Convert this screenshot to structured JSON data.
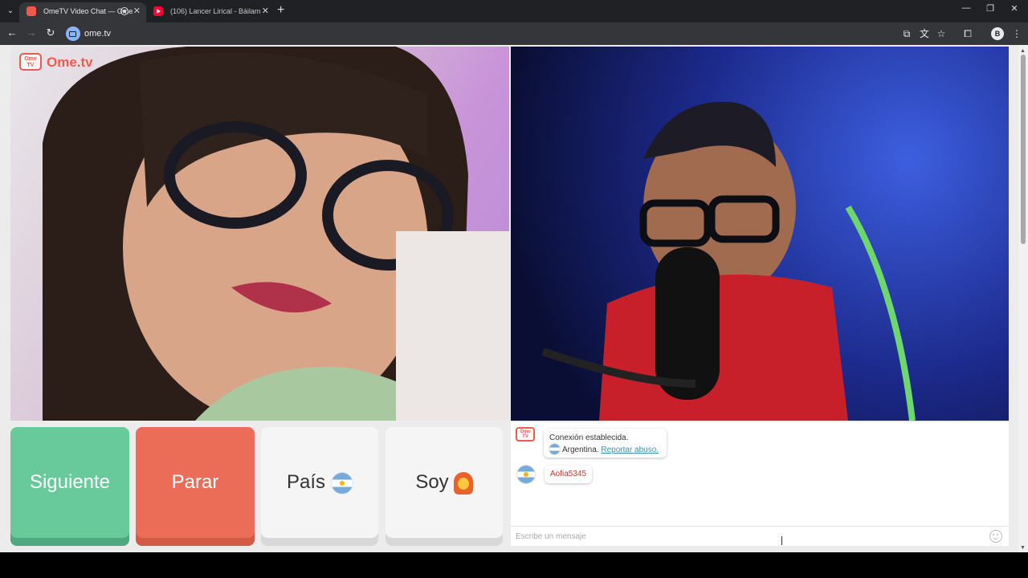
{
  "browser": {
    "tabs": [
      {
        "title": "OmeTV Video Chat — Ome",
        "active": true
      },
      {
        "title": "(106) Lancer Lirical - Báilame ft",
        "active": false
      }
    ],
    "url": "ome.tv",
    "profile_initial": "B"
  },
  "site": {
    "logo_text": "Ome.tv",
    "logo_badge": "Ome TV"
  },
  "controls": {
    "next_label": "Siguiente",
    "stop_label": "Parar",
    "country_label": "País",
    "gender_label": "Soy"
  },
  "chat": {
    "system_line1": "Conexión establecida.",
    "system_country": "Argentina.",
    "report_link": "Reportar abuso.",
    "message": "Aofia5345",
    "input_placeholder": "Escribe un mensaje"
  },
  "colors": {
    "next": "#68c99a",
    "stop": "#ec6d57",
    "brand": "#ee5a4d"
  }
}
